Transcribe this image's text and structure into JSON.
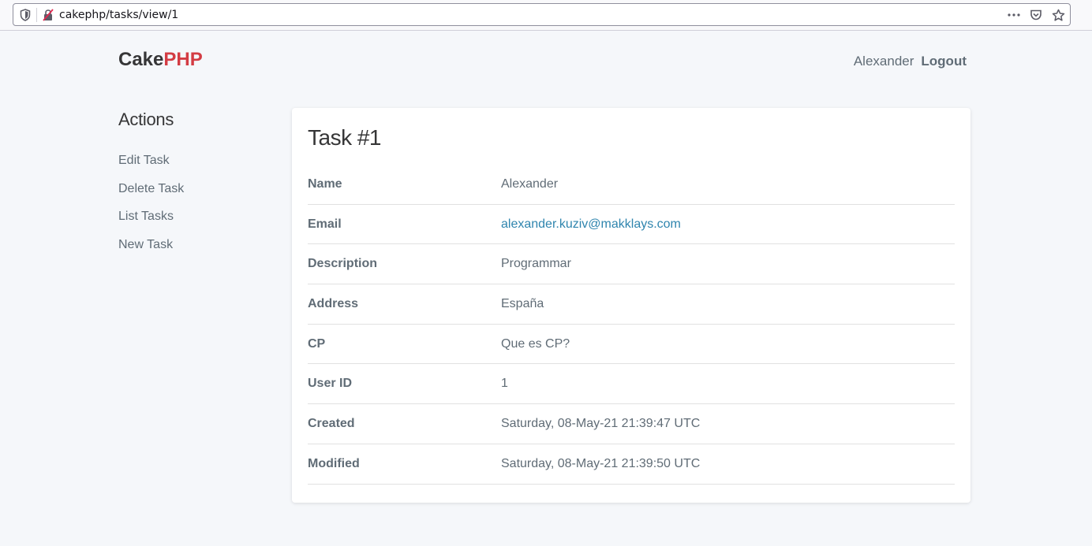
{
  "browser": {
    "url": "cakephp/tasks/view/1"
  },
  "header": {
    "brand_cake": "Cake",
    "brand_php": "PHP",
    "user_name": "Alexander",
    "logout_label": "Logout"
  },
  "sidebar": {
    "heading": "Actions",
    "items": [
      {
        "label": "Edit Task"
      },
      {
        "label": "Delete Task"
      },
      {
        "label": "List Tasks"
      },
      {
        "label": "New Task"
      }
    ]
  },
  "task": {
    "title": "Task #1",
    "fields": [
      {
        "key": "Name",
        "value": "Alexander"
      },
      {
        "key": "Email",
        "value": "alexander.kuziv@makklays.com"
      },
      {
        "key": "Description",
        "value": "Programmar"
      },
      {
        "key": "Address",
        "value": "España"
      },
      {
        "key": "CP",
        "value": "Que es CP?"
      },
      {
        "key": "User ID",
        "value": "1"
      },
      {
        "key": "Created",
        "value": "Saturday, 08-May-21 21:39:47 UTC"
      },
      {
        "key": "Modified",
        "value": "Saturday, 08-May-21 21:39:50 UTC"
      }
    ]
  },
  "colors": {
    "brand_dark": "#363637",
    "brand_red": "#d33c43",
    "text": "#606c76",
    "link": "#2f85ae",
    "background": "#f5f7fa"
  }
}
